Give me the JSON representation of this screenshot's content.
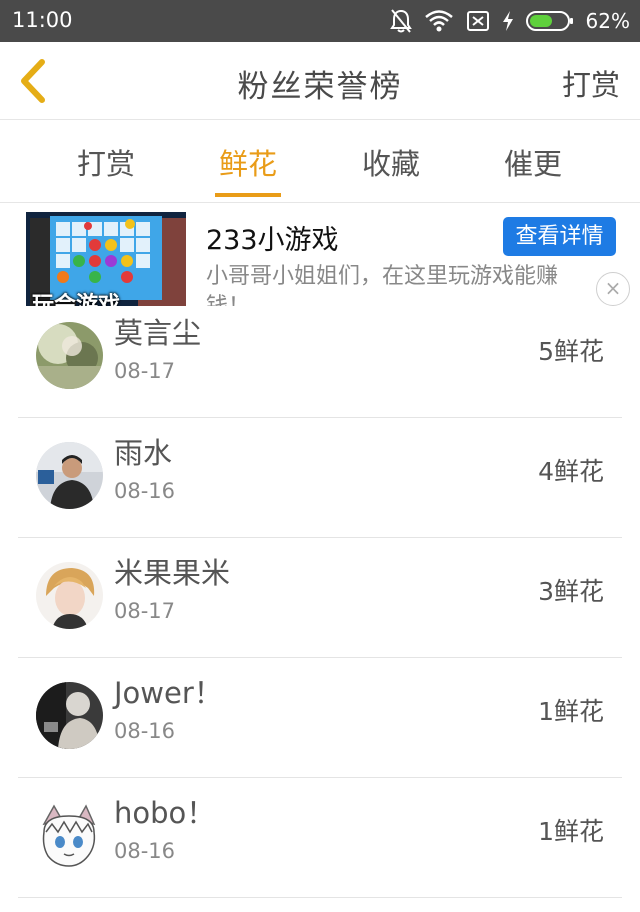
{
  "status_bar": {
    "time": "11:00",
    "battery_percent": "62%",
    "battery_level": 0.62,
    "icons": [
      "mute-bell-icon",
      "wifi-icon",
      "no-sim-icon",
      "charging-icon",
      "battery-icon"
    ]
  },
  "header": {
    "back_icon": "chevron-left-icon",
    "title": "粉丝荣誉榜",
    "action_label": "打赏"
  },
  "tabs": [
    {
      "label": "打赏",
      "active": false
    },
    {
      "label": "鲜花",
      "active": true
    },
    {
      "label": "收藏",
      "active": false
    },
    {
      "label": "催更",
      "active": false
    }
  ],
  "ad": {
    "title": "233小游戏",
    "button_label": "查看详情",
    "description_line1": "小哥哥小姐姐们，在这里玩游戏能赚",
    "description_line2": "钱！",
    "image_caption": "玩会游戏",
    "close_label": "×"
  },
  "fans": [
    {
      "name": "莫言尘",
      "date": "08-17",
      "count": "5鲜花"
    },
    {
      "name": "雨水",
      "date": "08-16",
      "count": "4鲜花"
    },
    {
      "name": "米果果米",
      "date": "08-17",
      "count": "3鲜花"
    },
    {
      "name": "Jower！",
      "date": "08-16",
      "count": "1鲜花"
    },
    {
      "name": "hobo！",
      "date": "08-16",
      "count": "1鲜花"
    }
  ],
  "colors": {
    "status_bar_bg": "#4a4a4a",
    "accent": "#e99c18",
    "ad_button": "#1e7be4",
    "battery_fill": "#5fd03c"
  }
}
